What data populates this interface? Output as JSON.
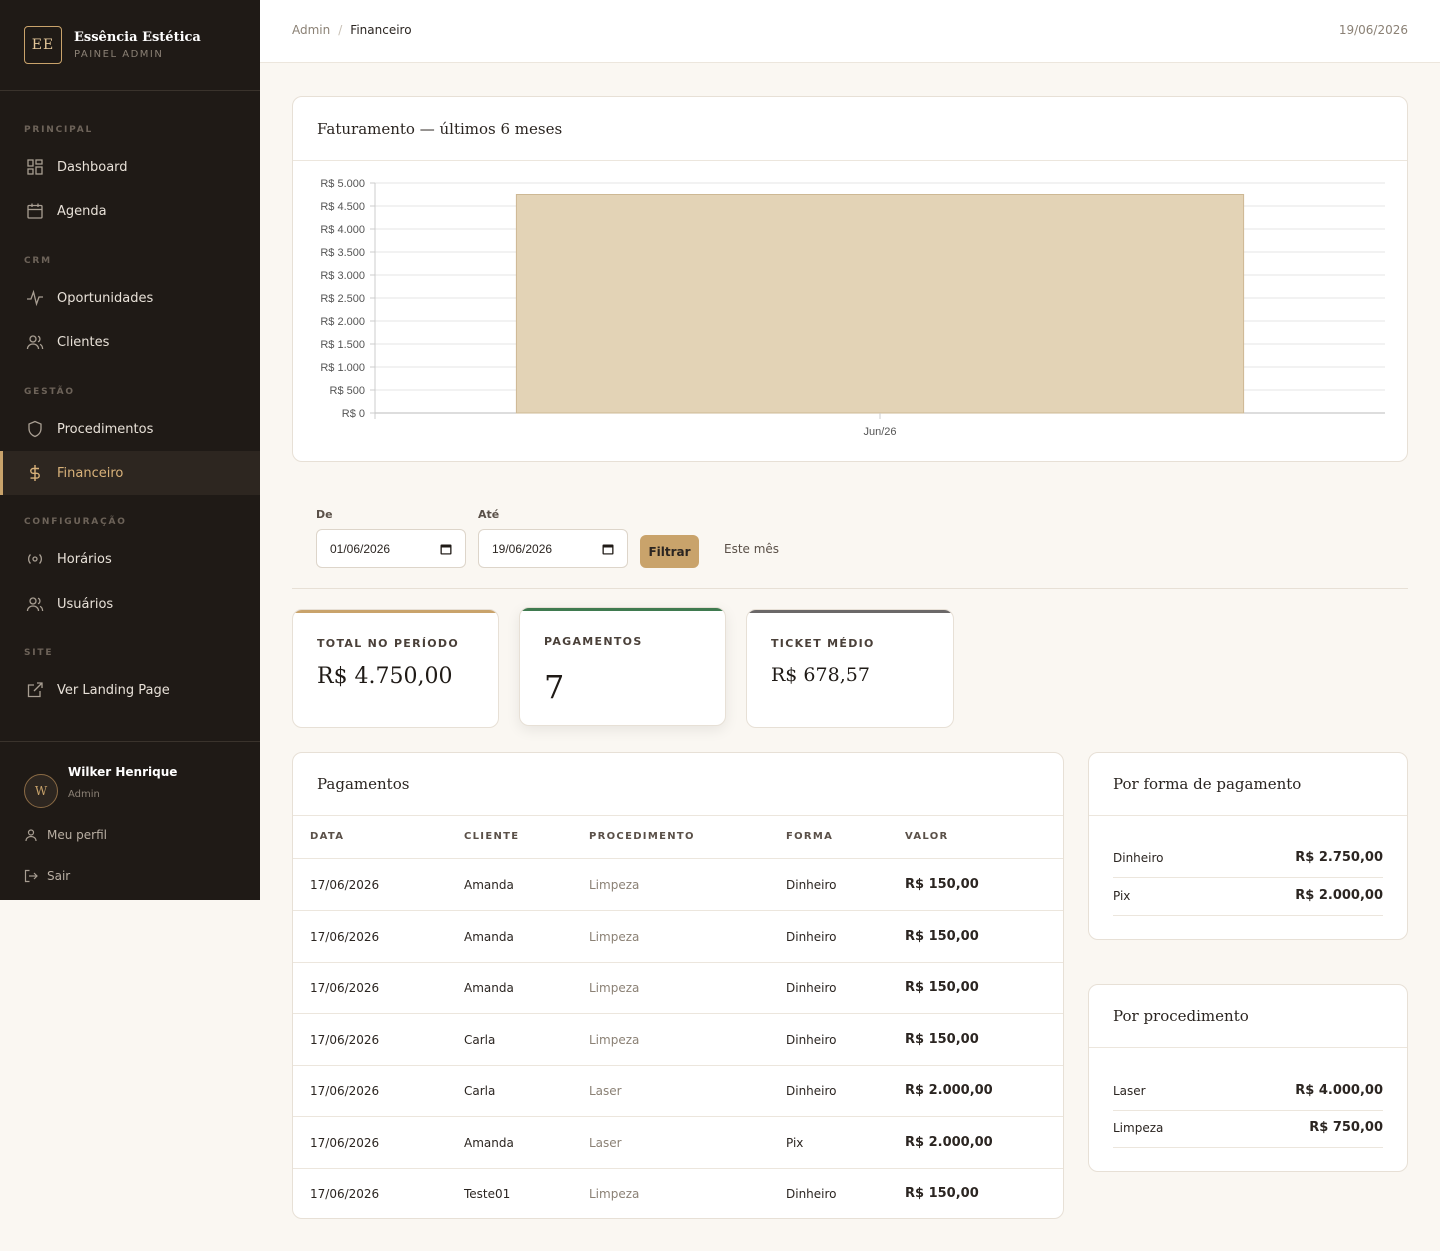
{
  "brand": {
    "logo": "EE",
    "name": "Essência Estética",
    "subtitle": "PAINEL ADMIN"
  },
  "sidebar": {
    "sections": [
      {
        "label": "PRINCIPAL",
        "items": [
          {
            "label": "Dashboard",
            "icon": "grid-icon"
          },
          {
            "label": "Agenda",
            "icon": "calendar-icon"
          }
        ]
      },
      {
        "label": "CRM",
        "items": [
          {
            "label": "Oportunidades",
            "icon": "activity-icon"
          },
          {
            "label": "Clientes",
            "icon": "users-icon"
          }
        ]
      },
      {
        "label": "GESTÃO",
        "items": [
          {
            "label": "Procedimentos",
            "icon": "shield-icon"
          },
          {
            "label": "Financeiro",
            "icon": "dollar-icon",
            "active": true
          }
        ]
      },
      {
        "label": "CONFIGURAÇÃO",
        "items": [
          {
            "label": "Horários",
            "icon": "radio-icon"
          },
          {
            "label": "Usuários",
            "icon": "users-icon"
          }
        ]
      },
      {
        "label": "SITE",
        "items": [
          {
            "label": "Ver Landing Page",
            "icon": "external-link-icon"
          }
        ]
      }
    ]
  },
  "user": {
    "initial": "W",
    "name": "Wilker Henrique",
    "role": "Admin",
    "profile_label": "Meu perfil",
    "logout_label": "Sair"
  },
  "topbar": {
    "crumb_root": "Admin",
    "crumb_sep": "/",
    "crumb_current": "Financeiro",
    "date": "19/06/2026"
  },
  "chart_card": {
    "title": "Faturamento — últimos 6 meses"
  },
  "chart_data": {
    "type": "bar",
    "categories": [
      "Jun/26"
    ],
    "values": [
      4750
    ],
    "ylim": [
      0,
      5000
    ],
    "yticks": [
      "R$ 0",
      "R$ 500",
      "R$ 1.000",
      "R$ 1.500",
      "R$ 2.000",
      "R$ 2.500",
      "R$ 3.000",
      "R$ 3.500",
      "R$ 4.000",
      "R$ 4.500",
      "R$ 5.000"
    ],
    "bar_color": "#e3d3b6",
    "grid": true
  },
  "filters": {
    "from_label": "De",
    "from_value": "01/06/2026",
    "to_label": "Até",
    "to_value": "19/06/2026",
    "filter_button": "Filtrar",
    "month_button": "Este mês"
  },
  "stats": [
    {
      "label": "TOTAL NO PERÍODO",
      "value": "R$ 4.750,00",
      "color": "#c9a36b"
    },
    {
      "label": "PAGAMENTOS",
      "value": "7",
      "color": "#3f7a4f"
    },
    {
      "label": "TICKET MÉDIO",
      "value": "R$ 678,57",
      "color": "#6b6868"
    }
  ],
  "payments": {
    "title": "Pagamentos",
    "columns": [
      "DATA",
      "CLIENTE",
      "PROCEDIMENTO",
      "FORMA",
      "VALOR"
    ],
    "rows": [
      [
        "17/06/2026",
        "Amanda",
        "Limpeza",
        "Dinheiro",
        "R$ 150,00"
      ],
      [
        "17/06/2026",
        "Amanda",
        "Limpeza",
        "Dinheiro",
        "R$ 150,00"
      ],
      [
        "17/06/2026",
        "Amanda",
        "Limpeza",
        "Dinheiro",
        "R$ 150,00"
      ],
      [
        "17/06/2026",
        "Carla",
        "Limpeza",
        "Dinheiro",
        "R$ 150,00"
      ],
      [
        "17/06/2026",
        "Carla",
        "Laser",
        "Dinheiro",
        "R$ 2.000,00"
      ],
      [
        "17/06/2026",
        "Amanda",
        "Laser",
        "Pix",
        "R$ 2.000,00"
      ],
      [
        "17/06/2026",
        "Teste01",
        "Limpeza",
        "Dinheiro",
        "R$ 150,00"
      ]
    ]
  },
  "by_method": {
    "title": "Por forma de pagamento",
    "rows": [
      [
        "Dinheiro",
        "R$ 2.750,00"
      ],
      [
        "Pix",
        "R$ 2.000,00"
      ]
    ]
  },
  "by_procedure": {
    "title": "Por procedimento",
    "rows": [
      [
        "Laser",
        "R$ 4.000,00"
      ],
      [
        "Limpeza",
        "R$ 750,00"
      ]
    ]
  }
}
